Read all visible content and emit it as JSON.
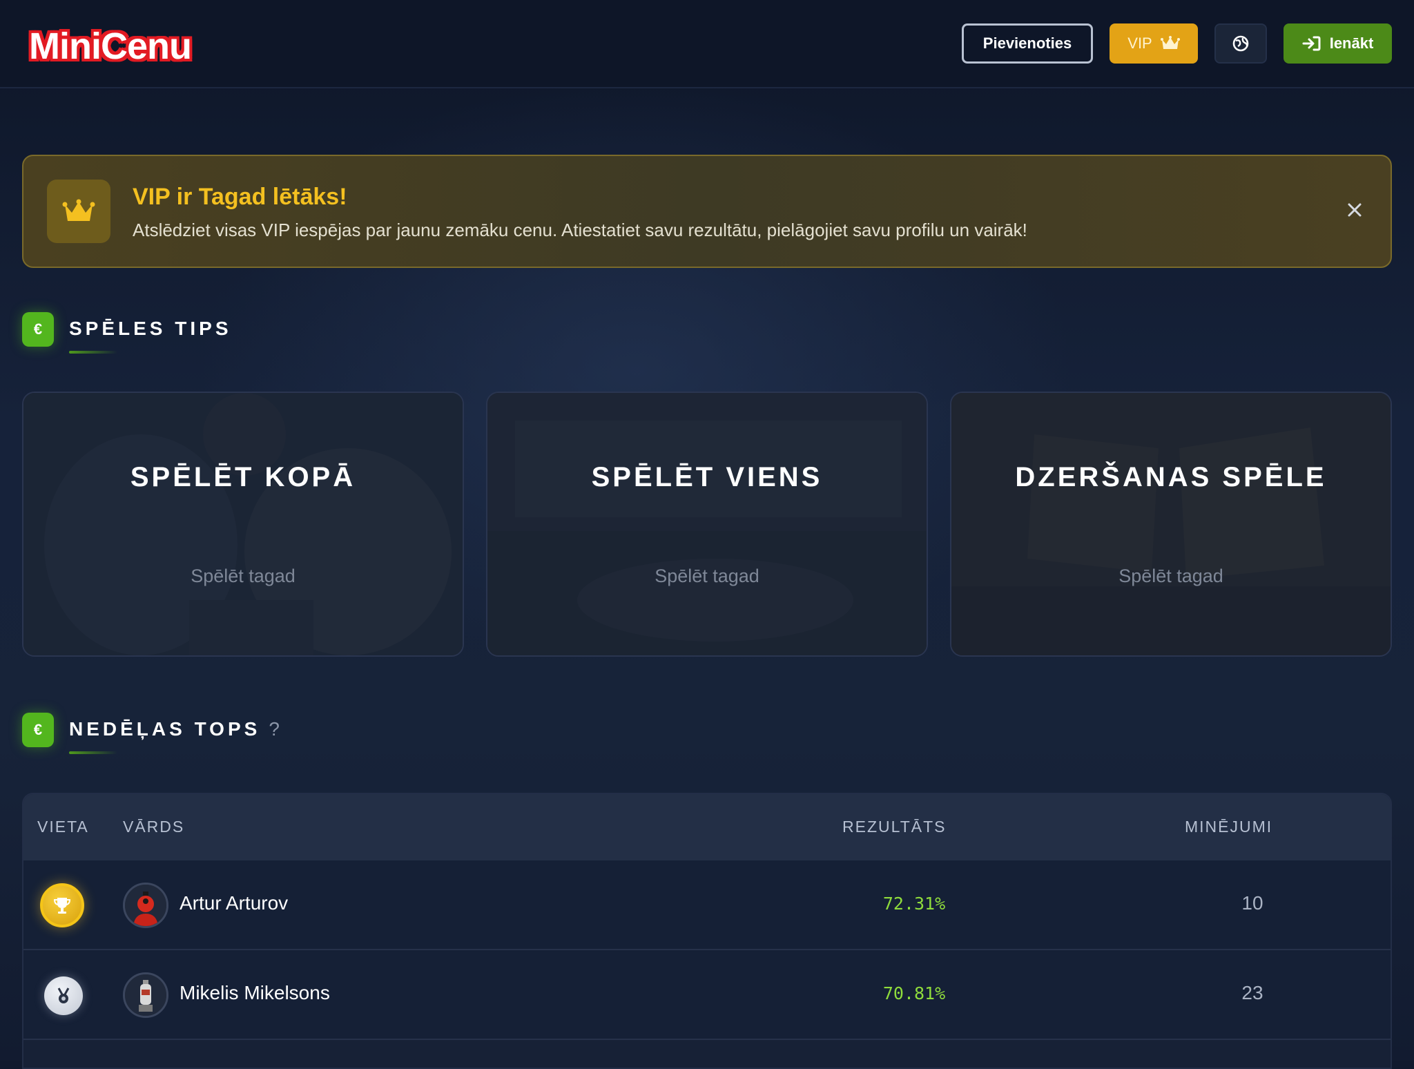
{
  "header": {
    "logo": "MINICENU",
    "join_label": "Pievienoties",
    "vip_label": "VIP",
    "login_label": "Ienākt",
    "icons": {
      "vip": "crown-icon",
      "lang": "globe-icon",
      "login": "sign-in-icon"
    }
  },
  "banner": {
    "title": "VIP ir Tagad lētāks!",
    "text": "Atslēdziet visas VIP iespējas par jaunu zemāku cenu. Atiestatiet savu rezultātu, pielāgojiet savu profilu un vairāk!",
    "icon": "crown-icon",
    "close_icon": "close-icon"
  },
  "sections": {
    "game_types": {
      "badge": "€",
      "title": "SPĒLES TIPS"
    },
    "weekly_top": {
      "badge": "€",
      "title": "NEDĒĻAS TOPS",
      "help": "?"
    }
  },
  "cards": [
    {
      "title": "SPĒLĒT KOPĀ",
      "subtitle": "Spēlēt tagad"
    },
    {
      "title": "SPĒLĒT VIENS",
      "subtitle": "Spēlēt tagad"
    },
    {
      "title": "DZERŠANAS SPĒLE",
      "subtitle": "Spēlēt tagad"
    }
  ],
  "leaderboard": {
    "columns": {
      "place": "VIETA",
      "name": "VĀRDS",
      "score": "REZULTĀTS",
      "guesses": "MINĒJUMI"
    },
    "rows": [
      {
        "medal": "gold-trophy-icon",
        "name": "Artur Arturov",
        "score": "72.31%",
        "guesses": "10"
      },
      {
        "medal": "silver-medal-icon",
        "name": "Mikelis Mikelsons",
        "score": "70.81%",
        "guesses": "23"
      }
    ]
  },
  "colors": {
    "accent_green": "#53b61e",
    "vip_gold": "#e3a316",
    "score_green": "#8fdc3c",
    "background": "#111a2e"
  }
}
